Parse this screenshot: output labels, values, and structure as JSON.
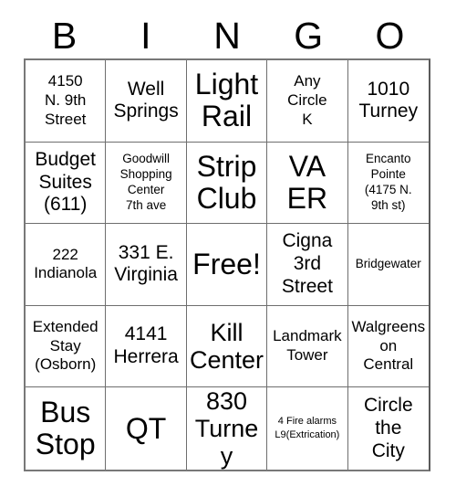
{
  "header": {
    "letters": [
      "B",
      "I",
      "N",
      "G",
      "O"
    ]
  },
  "grid": {
    "rows": 5,
    "columns": 5,
    "border_color": "#6e6e6e",
    "background_color": "#ffffff",
    "text_color": "#000000",
    "cells": [
      {
        "text": "4150\nN. 9th\nStreet",
        "size": "m",
        "free": false
      },
      {
        "text": "Well\nSprings",
        "size": "l",
        "free": false
      },
      {
        "text": "Light\nRail",
        "size": "xxl",
        "free": false
      },
      {
        "text": "Any\nCircle\nK",
        "size": "m",
        "free": false
      },
      {
        "text": "1010\nTurney",
        "size": "l",
        "free": false
      },
      {
        "text": "Budget\nSuites\n(611)",
        "size": "l",
        "free": false
      },
      {
        "text": "Goodwill\nShopping\nCenter\n7th ave",
        "size": "s",
        "free": false
      },
      {
        "text": "Strip\nClub",
        "size": "xxl",
        "free": false
      },
      {
        "text": "VA\nER",
        "size": "xxl",
        "free": false
      },
      {
        "text": "Encanto\nPointe\n(4175 N.\n9th st)",
        "size": "s",
        "free": false
      },
      {
        "text": "222\nIndianola",
        "size": "m",
        "free": false
      },
      {
        "text": "331 E.\nVirginia",
        "size": "l",
        "free": false
      },
      {
        "text": "Free!",
        "size": "xxl",
        "free": true
      },
      {
        "text": "Cigna\n3rd\nStreet",
        "size": "l",
        "free": false
      },
      {
        "text": "Bridgewater",
        "size": "s",
        "free": false
      },
      {
        "text": "Extended\nStay\n(Osborn)",
        "size": "m",
        "free": false
      },
      {
        "text": "4141\nHerrera",
        "size": "l",
        "free": false
      },
      {
        "text": "Kill\nCenter",
        "size": "xl",
        "free": false
      },
      {
        "text": "Landmark\nTower",
        "size": "m",
        "free": false
      },
      {
        "text": "Walgreens\non\nCentral",
        "size": "m",
        "free": false
      },
      {
        "text": "Bus\nStop",
        "size": "xxl",
        "free": false
      },
      {
        "text": "QT",
        "size": "xxl",
        "free": false
      },
      {
        "text": "830\nTurney",
        "size": "xl",
        "free": false
      },
      {
        "text": "4 Fire alarms\nL9(Extrication)",
        "size": "xs",
        "free": false
      },
      {
        "text": "Circle\nthe\nCity",
        "size": "l",
        "free": false
      }
    ]
  }
}
